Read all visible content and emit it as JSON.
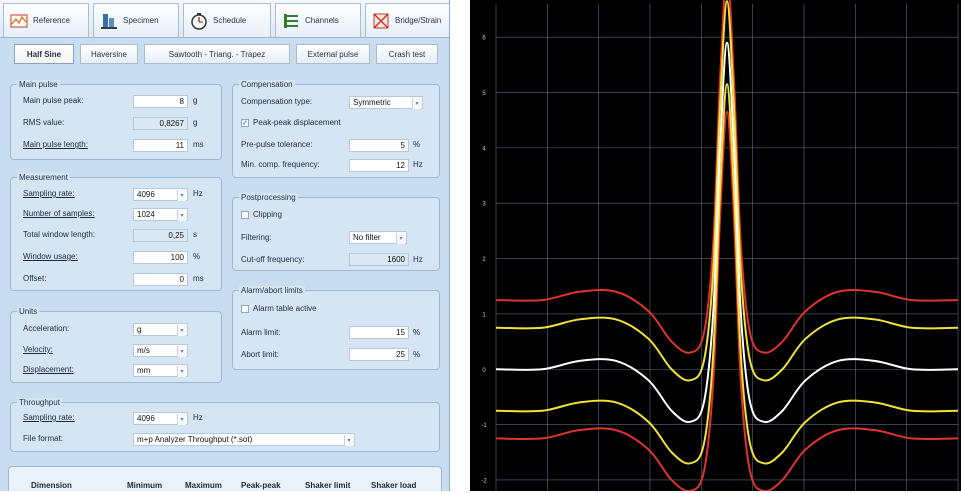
{
  "tabs": [
    {
      "label": "Reference",
      "icon": "reference-icon"
    },
    {
      "label": "Specimen",
      "icon": "specimen-icon"
    },
    {
      "label": "Schedule",
      "icon": "schedule-icon"
    },
    {
      "label": "Channels",
      "icon": "channels-icon"
    },
    {
      "label": "Bridge/Strain",
      "icon": "bridge-strain-icon"
    }
  ],
  "pulse_types": [
    "Half Sine",
    "Haversine",
    "Sawtooth - Triang. - Trapez",
    "External pulse",
    "Crash test"
  ],
  "main_pulse": {
    "title": "Main pulse",
    "peak_label": "Main pulse peak:",
    "peak_value": "8",
    "peak_unit": "g",
    "rms_label": "RMS value:",
    "rms_value": "0,8267",
    "rms_unit": "g",
    "length_label": "Main pulse length:",
    "length_value": "11",
    "length_unit": "ms"
  },
  "measurement": {
    "title": "Measurement",
    "sampling_label": "Sampling rate:",
    "sampling_value": "4096",
    "sampling_unit": "Hz",
    "samples_label": "Number of samples:",
    "samples_value": "1024",
    "window_len_label": "Total window length:",
    "window_len_value": "0,25",
    "window_len_unit": "s",
    "usage_label": "Window usage:",
    "usage_value": "100",
    "usage_unit": "%",
    "offset_label": "Offset:",
    "offset_value": "0",
    "offset_unit": "ms"
  },
  "units": {
    "title": "Units",
    "accel_label": "Acceleration:",
    "accel_value": "g",
    "velocity_label": "Velocity:",
    "velocity_value": "m/s",
    "disp_label": "Displacement:",
    "disp_value": "mm"
  },
  "throughput": {
    "title": "Throughput",
    "sampling_label": "Sampling rate:",
    "sampling_value": "4096",
    "sampling_unit": "Hz",
    "format_label": "File format:",
    "format_value": "m+p Analyzer Throughput (*.sot)"
  },
  "compensation": {
    "title": "Compensation",
    "type_label": "Compensation type:",
    "type_value": "Symmetric",
    "peak_disp_label": "Peak-peak displacement",
    "peak_disp_checked": true,
    "prepulse_label": "Pre-pulse tolerance:",
    "prepulse_value": "5",
    "prepulse_unit": "%",
    "minfreq_label": "Min. comp. frequency:",
    "minfreq_value": "12",
    "minfreq_unit": "Hz"
  },
  "postprocessing": {
    "title": "Postprocessing",
    "clipping_label": "Clipping",
    "clipping_checked": false,
    "filter_label": "Filtering:",
    "filter_value": "No filter",
    "cutoff_label": "Cut-off frequency:",
    "cutoff_value": "1600",
    "cutoff_unit": "Hz"
  },
  "alarm": {
    "title": "Alarm/abort limits",
    "table_label": "Alarm table active",
    "table_checked": false,
    "alarm_label": "Alarm limit:",
    "alarm_value": "15",
    "alarm_unit": "%",
    "abort_label": "Abort limit:",
    "abort_value": "25",
    "abort_unit": "%"
  },
  "table": {
    "headers": [
      "Dimension",
      "Minimum",
      "Maximum",
      "Peak-peak",
      "Shaker limit",
      "Shaker load"
    ]
  },
  "colors": {
    "plot_bg": "#000000",
    "grid": "#5a6a80",
    "limit_outer": "#e0332e",
    "limit_inner": "#f0e23a",
    "reference": "#ffffff",
    "tick": "#cccccc"
  },
  "chart_data": {
    "type": "line",
    "y_ticks": [
      "6",
      "5",
      "4",
      "3",
      "2",
      "1",
      "0",
      "-1",
      "-2"
    ],
    "ylim": [
      -2.2,
      6.6
    ],
    "grid": true,
    "series": [
      {
        "role": "reference",
        "color": "#ffffff",
        "offset": 0,
        "scale": 1.0
      },
      {
        "role": "alarm-upper",
        "color": "#f0e23a",
        "offset": 0.75,
        "scale": 1.0
      },
      {
        "role": "alarm-lower",
        "color": "#f0e23a",
        "offset": -0.75,
        "scale": 1.0
      },
      {
        "role": "abort-upper",
        "color": "#e0332e",
        "offset": 1.25,
        "scale": 1.0
      },
      {
        "role": "abort-lower",
        "color": "#e0332e",
        "offset": -1.25,
        "scale": 1.0
      }
    ],
    "shape_x": [
      0,
      0.1,
      0.18,
      0.26,
      0.33,
      0.38,
      0.42,
      0.45,
      0.47,
      0.485,
      0.5,
      0.515,
      0.53,
      0.55,
      0.58,
      0.62,
      0.67,
      0.74,
      0.82,
      0.9,
      1.0
    ],
    "shape_y": [
      0,
      0,
      0.15,
      0.15,
      -0.2,
      -0.75,
      -0.95,
      -0.6,
      1.0,
      4.0,
      5.9,
      4.0,
      1.0,
      -0.6,
      -0.95,
      -0.75,
      -0.2,
      0.15,
      0.15,
      0,
      0
    ]
  }
}
